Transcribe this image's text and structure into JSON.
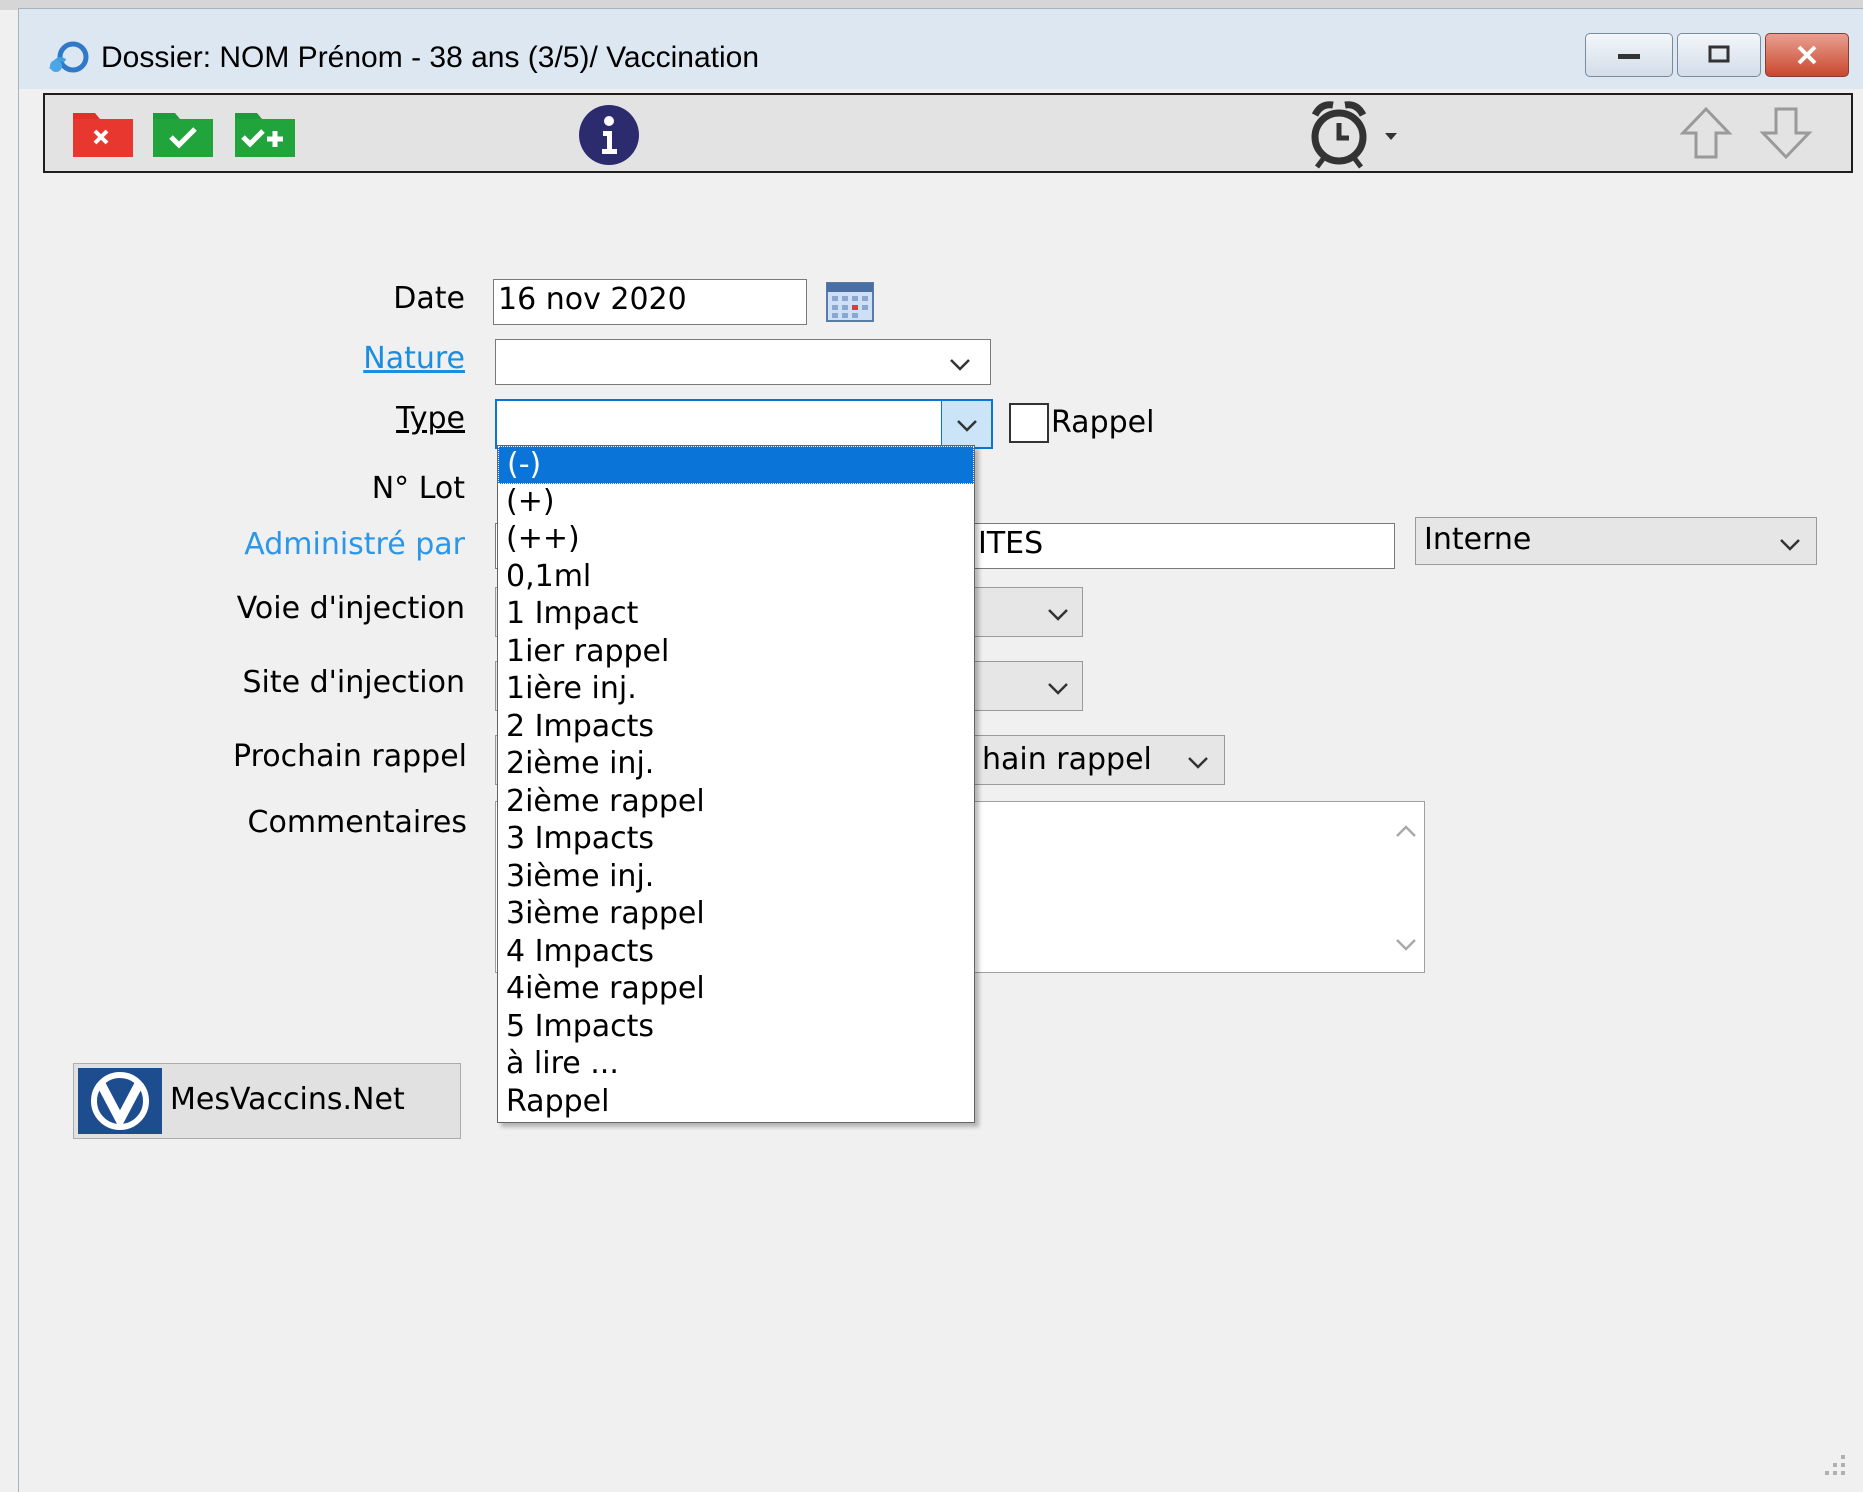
{
  "window": {
    "title": "Dossier: NOM Prénom - 38 ans (3/5)/ Vaccination",
    "controls": [
      "minimize",
      "restore",
      "close"
    ]
  },
  "toolbar": {
    "icons": [
      "folder-cancel-icon",
      "folder-save-icon",
      "folder-save-add-icon",
      "info-icon",
      "alarm-clock-icon",
      "arrow-up-icon",
      "arrow-down-icon"
    ]
  },
  "form": {
    "date": {
      "label": "Date",
      "value": "16 nov 2020"
    },
    "nature": {
      "label": "Nature",
      "value": ""
    },
    "type": {
      "label": "Type",
      "value": ""
    },
    "rappel_checkbox": {
      "label": "Rappel",
      "checked": false
    },
    "lot": {
      "label": "N° Lot"
    },
    "administre_par": {
      "label": "Administré par",
      "value_visible": "ITES",
      "select_value": "Interne"
    },
    "voie": {
      "label": "Voie d'injection"
    },
    "site": {
      "label": "Site d'injection"
    },
    "prochain_rappel": {
      "label": "Prochain rappel",
      "select_visible": "hain rappel"
    },
    "commentaires": {
      "label": "Commentaires",
      "value": ""
    }
  },
  "type_dropdown": {
    "selected": "(-)",
    "options": [
      "(-)",
      "(+)",
      "(++)",
      "0,1ml",
      "1 Impact",
      "1ier rappel",
      "1ière inj.",
      "2 Impacts",
      "2ième inj.",
      "2ième rappel",
      "3 Impacts",
      "3ième inj.",
      "3ième rappel",
      "4 Impacts",
      "4ième rappel",
      "5 Impacts",
      "à lire ...",
      "Rappel"
    ]
  },
  "mesvaccins": {
    "label": "MesVaccins.Net"
  }
}
